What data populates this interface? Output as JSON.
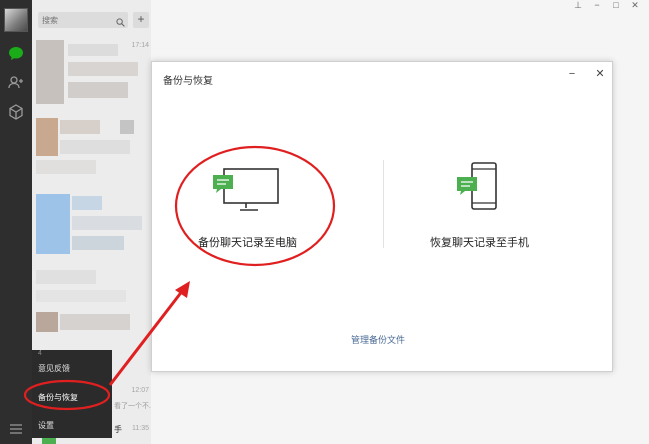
{
  "chat_list": {
    "search_placeholder": "搜索",
    "add_label": "+",
    "times": [
      "17:14",
      "12:07",
      "11:35"
    ],
    "preview_fragment": "看了一个不...",
    "name_fragment": "手",
    "item_fragment": "4"
  },
  "menu": {
    "items": [
      {
        "label": "意见反馈"
      },
      {
        "label": "备份与恢复"
      },
      {
        "label": "设置"
      }
    ]
  },
  "window_controls": {
    "pin": "⊥",
    "minimize": "−",
    "maximize": "□",
    "close": "✕"
  },
  "dialog": {
    "title": "备份与恢复",
    "minimize": "−",
    "close": "✕",
    "backup_to_pc": "备份聊天记录至电脑",
    "restore_to_phone": "恢复聊天记录至手机",
    "manage_link": "管理备份文件"
  },
  "colors": {
    "rail": "#2e2e2e",
    "chat_icon_active": "#1aad19",
    "annotation_red": "#e02020",
    "icon_green": "#4caf50",
    "link": "#4a6a94"
  },
  "icons": {
    "chats": "chat-bubble-icon",
    "contacts": "contacts-icon",
    "favorites": "cube-icon",
    "menu": "hamburger-icon",
    "search": "search-icon"
  }
}
